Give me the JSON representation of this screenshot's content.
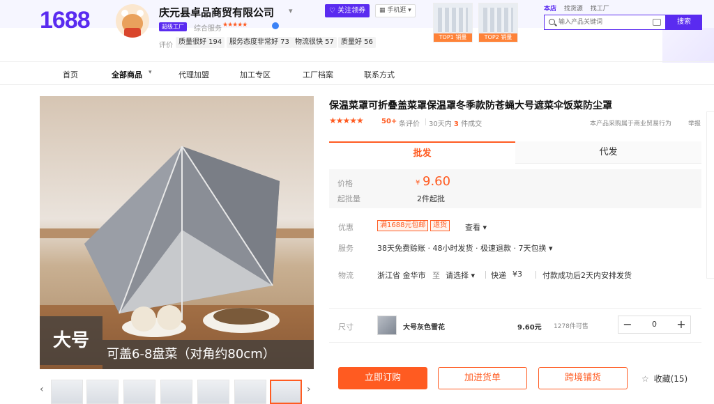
{
  "header": {
    "logo": "1688",
    "shop_name": "庆元县卓品商贸有限公司",
    "factory_badge": "超级工厂",
    "service_label": "综合服务",
    "service_stars": "★★★★★",
    "eval_label": "评价",
    "tags": [
      "质量很好 194",
      "服务态度非常好 73",
      "物流很快 57",
      "质量好 56"
    ],
    "follow_button": "关注领券",
    "mobile_button": "手机逛",
    "top_thumbs": [
      "TOP1 销量",
      "TOP2 销量"
    ],
    "search_tabs": [
      "本店",
      "找货源",
      "找工厂"
    ],
    "search_placeholder": "输入产品关键词",
    "search_button": "搜索"
  },
  "nav": {
    "items": [
      "首页",
      "全部商品",
      "代理加盟",
      "加工专区",
      "工厂档案",
      "联系方式"
    ]
  },
  "image": {
    "caption_big": "大号",
    "caption": "可盖6-8盘菜（对角约80cm）"
  },
  "product": {
    "title": "保温菜罩可折叠盖菜罩保温罩冬季款防苍蝇大号遮菜伞饭菜防尘罩",
    "stars": "★★★★★",
    "review_count": "50+",
    "review_label": "条评价",
    "deal_prefix": "30天内",
    "deal_count": "3",
    "deal_suffix": "件成交",
    "trade_note": "本产品采购属于商业贸易行为",
    "report": "举报"
  },
  "tabs": [
    "批发",
    "代发"
  ],
  "price": {
    "price_label": "价格",
    "currency": "¥",
    "value": "9.60",
    "moq_label": "起批量",
    "moq": "2件起批"
  },
  "offers": {
    "label": "优惠",
    "coupons": [
      "满1688元包邮",
      "退货"
    ],
    "more": "查看"
  },
  "service": {
    "label": "服务",
    "text": "38天免费赊账 · 48小时发货 · 极速退款 · 7天包换"
  },
  "logistics": {
    "label": "物流",
    "origin": "浙江省 金华市",
    "to": "至",
    "choose": "请选择",
    "express": "快递",
    "fee": "¥3",
    "ship_note": "付款成功后2天内安排发货"
  },
  "sku": {
    "label": "尺寸",
    "name": "大号灰色雪花",
    "price": "9.60元",
    "stock": "1278件可售",
    "qty": "0",
    "minus": "−",
    "plus": "+"
  },
  "actions": {
    "buy_now": "立即订购",
    "add_cart": "加进货单",
    "cross_border": "跨境铺货",
    "favorite": "收藏(15)"
  },
  "colors": {
    "brand": "#5a2bf0",
    "accent": "#ff5b21"
  }
}
